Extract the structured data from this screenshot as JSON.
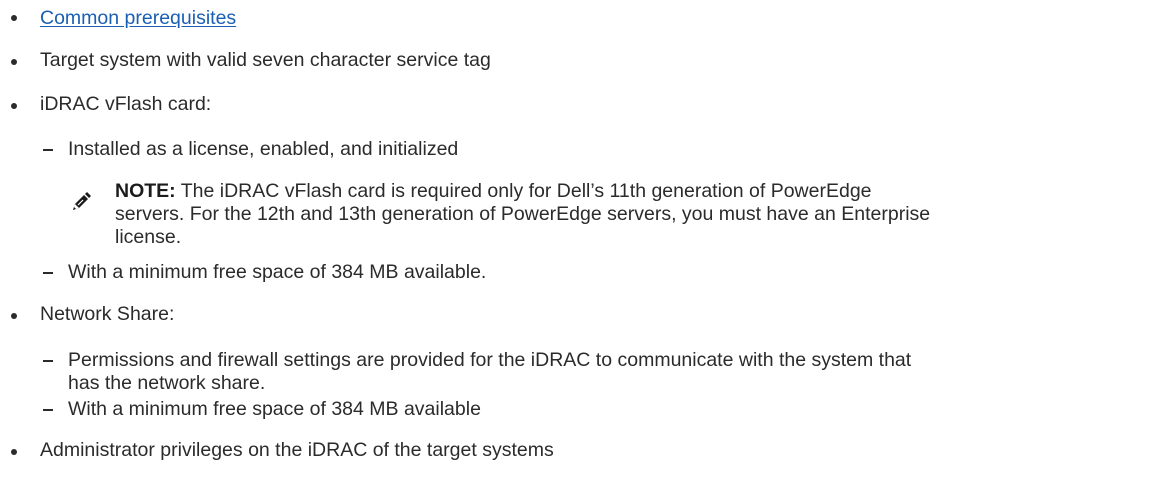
{
  "items": [
    {
      "text": "Common prerequisites",
      "link": true
    },
    {
      "text": "Target system with valid seven character service tag"
    },
    {
      "text": "iDRAC vFlash card:"
    },
    {
      "text": "Installed as a license, enabled, and initialized"
    },
    {
      "text": "With a minimum free space of 384 MB available."
    },
    {
      "text": "Network Share:"
    },
    {
      "text": "Permissions and firewall settings are provided for the iDRAC to communicate with the system that"
    },
    {
      "text": "has the network share."
    },
    {
      "text": "With a minimum free space of 384 MB available"
    },
    {
      "text": "Administrator privileges on the iDRAC of the target systems"
    }
  ],
  "note": {
    "label": "NOTE:",
    "line1": " The iDRAC vFlash card is required only for Dell’s 11th generation of PowerEdge",
    "line2": "servers. For the 12th and 13th generation of PowerEdge servers, you must have an Enterprise",
    "line3": "license.",
    "icon": "pencil-note-icon"
  }
}
